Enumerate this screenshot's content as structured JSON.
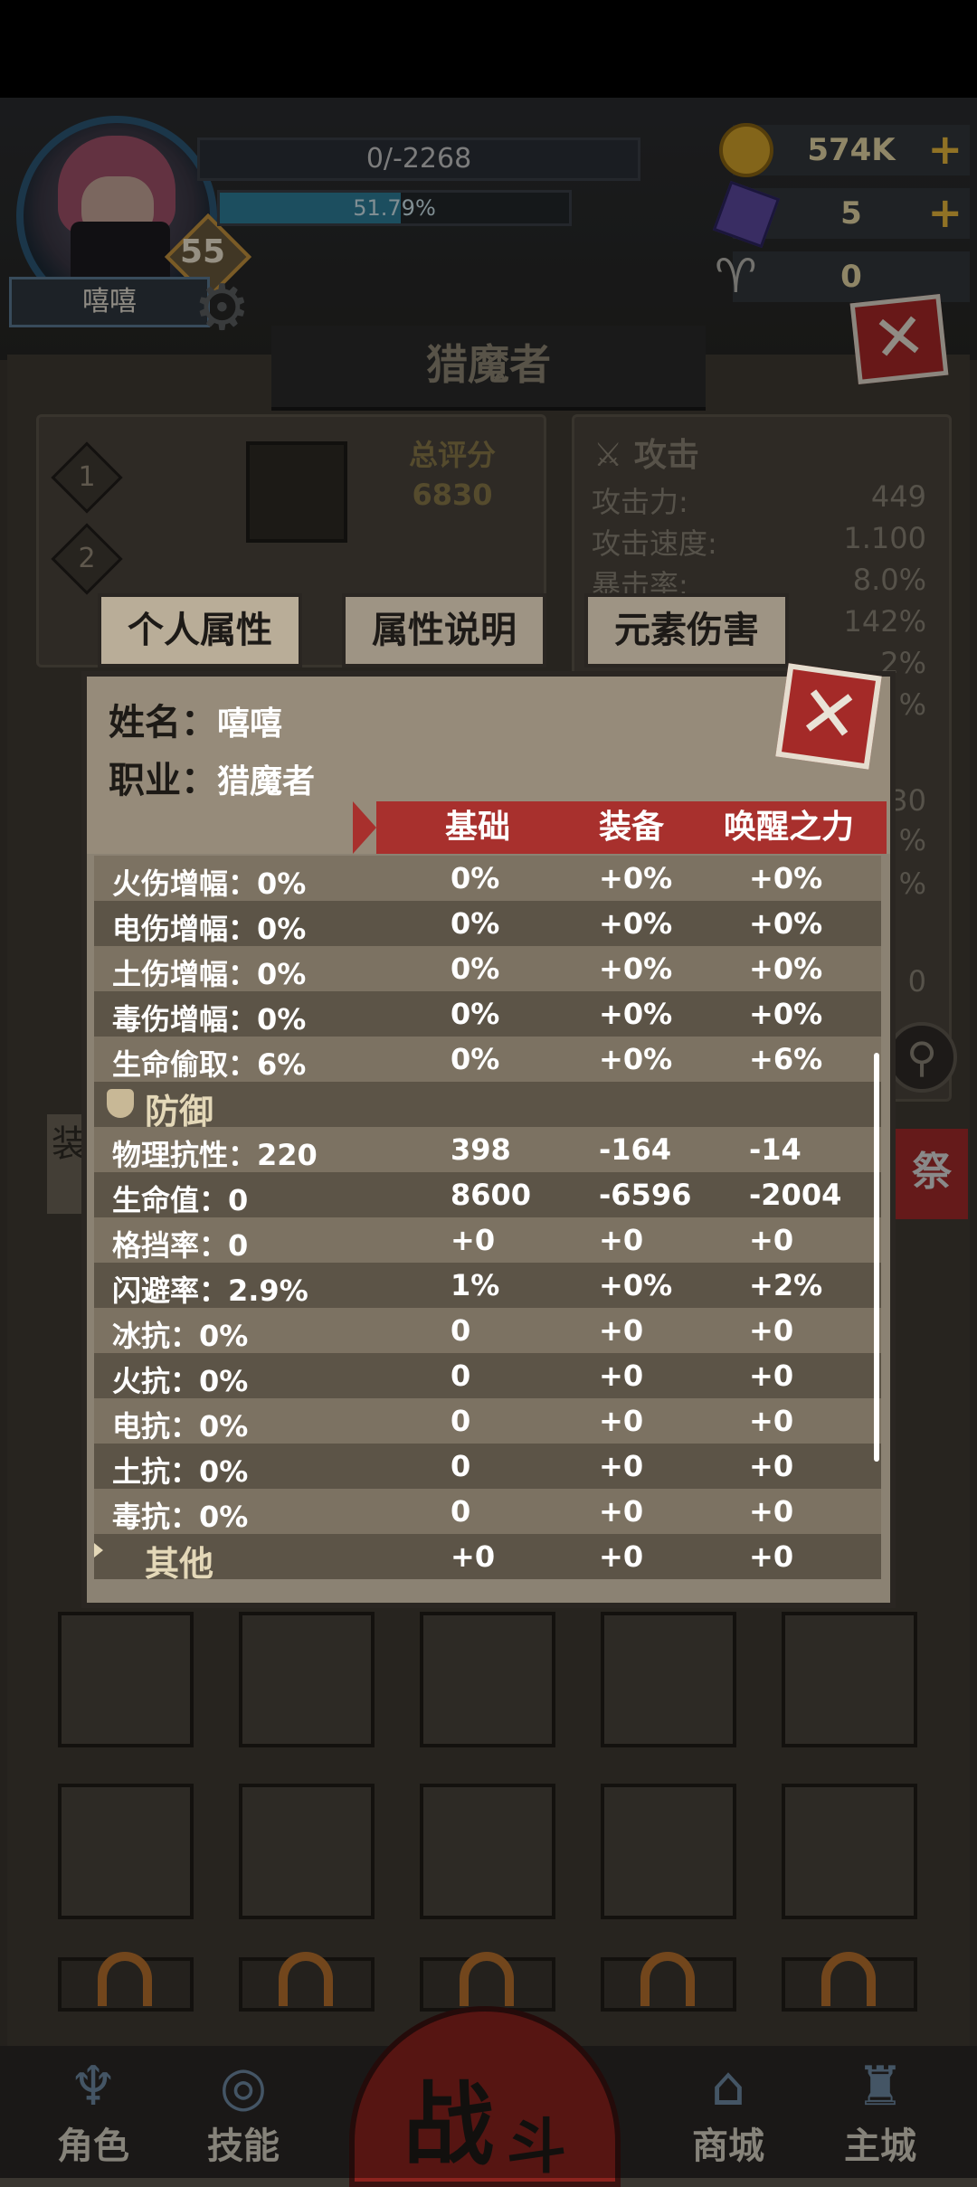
{
  "player": {
    "name": "嘻嘻",
    "level": "55",
    "exp_text": "0/-2268",
    "hp_percent_text": "51.79%",
    "hp_fraction": 0.5179
  },
  "resources": {
    "gold": "574K",
    "gems": "5",
    "ram": "0",
    "plus": "+"
  },
  "page": {
    "title": "猎魔者",
    "close": "✕"
  },
  "panel": {
    "slot1": "1",
    "slot2": "2",
    "score_label": "总评分",
    "score_value": "6830"
  },
  "attack": {
    "title": "攻击",
    "rows": [
      {
        "label": "攻击力:",
        "value": "449"
      },
      {
        "label": "攻击速度:",
        "value": "1.100"
      },
      {
        "label": "暴击率:",
        "value": "8.0%"
      },
      {
        "label": "",
        "value": "142%"
      },
      {
        "label": "",
        "value": "2%"
      },
      {
        "label": "",
        "value": "%"
      }
    ],
    "partial_values": [
      "30",
      "%",
      "%",
      "0"
    ]
  },
  "tabs": {
    "personal": "个人属性",
    "explain": "属性说明",
    "element": "元素伤害"
  },
  "popup": {
    "name_label": "姓名：",
    "name_value": "嘻嘻",
    "job_label": "职业：",
    "job_value": "猎魔者",
    "close": "✕",
    "columns": [
      "基础",
      "装备",
      "唤醒之力"
    ]
  },
  "stats": {
    "rows": [
      {
        "label": "火伤增幅：0%",
        "base": "0%",
        "equip": "+0%",
        "awake": "+0%"
      },
      {
        "label": "电伤增幅：0%",
        "base": "0%",
        "equip": "+0%",
        "awake": "+0%"
      },
      {
        "label": "土伤增幅：0%",
        "base": "0%",
        "equip": "+0%",
        "awake": "+0%"
      },
      {
        "label": "毒伤增幅：0%",
        "base": "0%",
        "equip": "+0%",
        "awake": "+0%"
      },
      {
        "label": "生命偷取：6%",
        "base": "0%",
        "equip": "+0%",
        "awake": "+6%"
      },
      {
        "section": "防御"
      },
      {
        "label": "物理抗性：220",
        "base": "398",
        "equip": "-164",
        "awake": "-14"
      },
      {
        "label": "生命值：0",
        "base": "8600",
        "equip": "-6596",
        "awake": "-2004"
      },
      {
        "label": "格挡率：0",
        "base": "+0",
        "equip": "+0",
        "awake": "+0"
      },
      {
        "label": "闪避率：2.9%",
        "base": "1%",
        "equip": "+0%",
        "awake": "+2%"
      },
      {
        "label": "冰抗：0%",
        "base": "0",
        "equip": "+0",
        "awake": "+0"
      },
      {
        "label": "火抗：0%",
        "base": "0",
        "equip": "+0",
        "awake": "+0"
      },
      {
        "label": "电抗：0%",
        "base": "0",
        "equip": "+0",
        "awake": "+0"
      },
      {
        "label": "土抗：0%",
        "base": "0",
        "equip": "+0",
        "awake": "+0"
      },
      {
        "label": "毒抗：0%",
        "base": "0",
        "equip": "+0",
        "awake": "+0"
      },
      {
        "section": "其他",
        "base": "+0",
        "equip": "+0",
        "awake": "+0"
      }
    ]
  },
  "side": {
    "left_tab": "装",
    "right_tab": "祭"
  },
  "nav": {
    "role": "角色",
    "skill": "技能",
    "fight_big": "战",
    "fight_small": "斗",
    "shop": "商城",
    "city": "主城"
  },
  "colors": {
    "accent_red": "#a8302d",
    "gold": "#d4a32a",
    "hp_blue": "#2e7f9a"
  }
}
